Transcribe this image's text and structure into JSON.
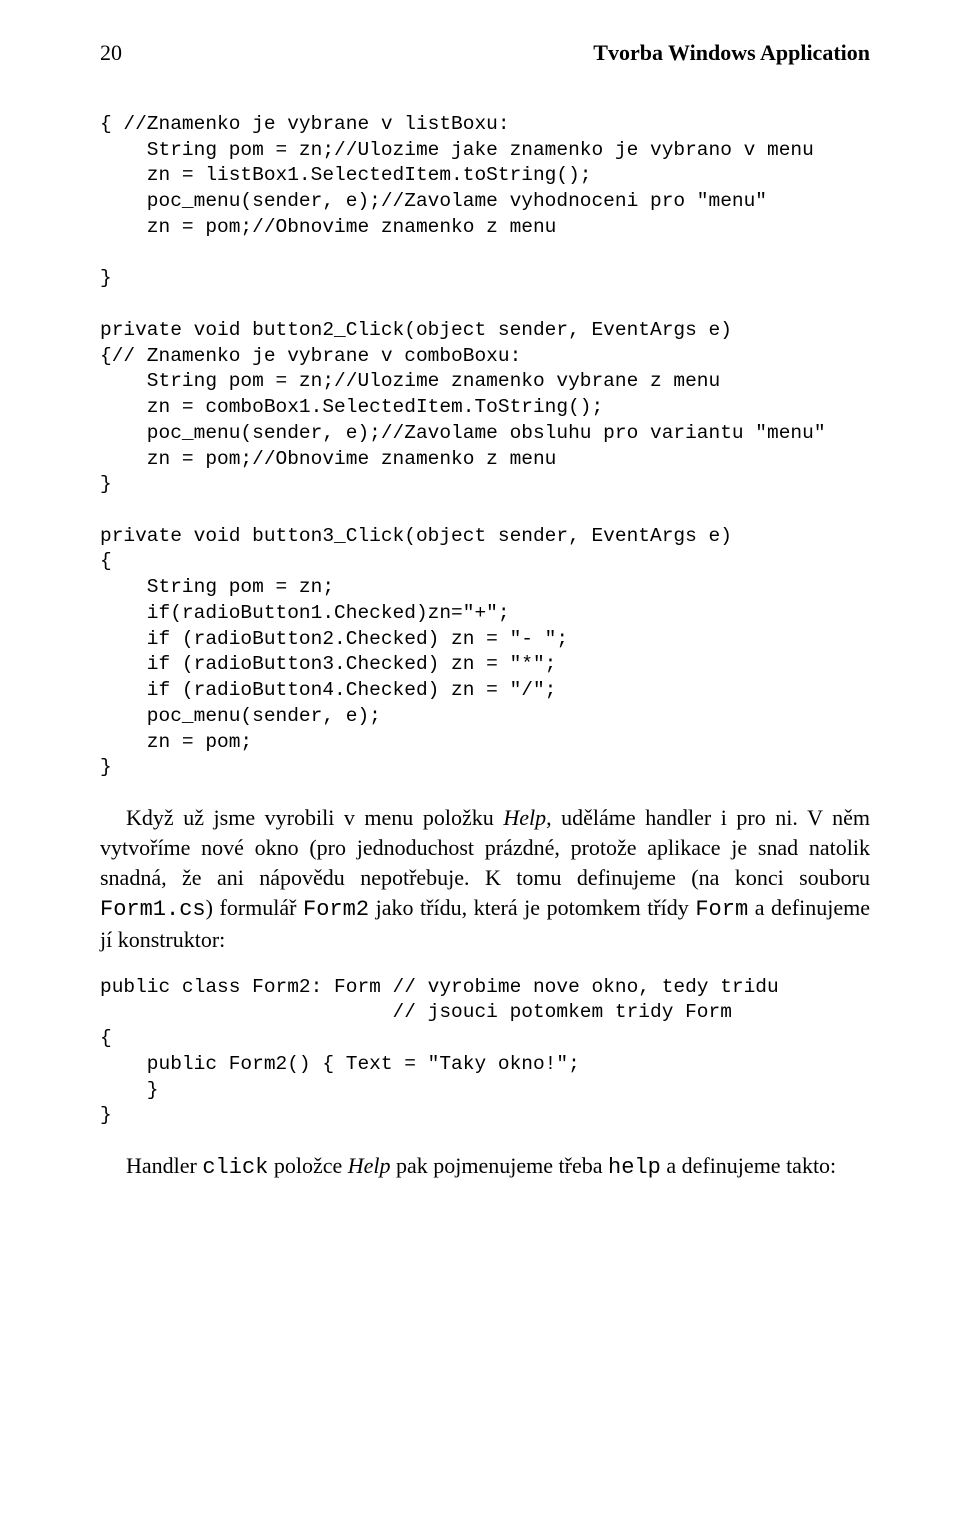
{
  "header": {
    "page_number": "20",
    "chapter_title": "Tvorba Windows Application"
  },
  "code1": "{ //Znamenko je vybrane v listBoxu:\n    String pom = zn;//Ulozime jake znamenko je vybrano v menu\n    zn = listBox1.SelectedItem.toString();\n    poc_menu(sender, e);//Zavolame vyhodnoceni pro \"menu\"\n    zn = pom;//Obnovime znamenko z menu\n\n}\n\nprivate void button2_Click(object sender, EventArgs e)\n{// Znamenko je vybrane v comboBoxu:\n    String pom = zn;//Ulozime znamenko vybrane z menu\n    zn = comboBox1.SelectedItem.ToString();\n    poc_menu(sender, e);//Zavolame obsluhu pro variantu \"menu\"\n    zn = pom;//Obnovime znamenko z menu\n}\n\nprivate void button3_Click(object sender, EventArgs e)\n{\n    String pom = zn;\n    if(radioButton1.Checked)zn=\"+\";\n    if (radioButton2.Checked) zn = \"- \";\n    if (radioButton3.Checked) zn = \"*\";\n    if (radioButton4.Checked) zn = \"/\";\n    poc_menu(sender, e);\n    zn = pom;\n}",
  "para1": {
    "t1": "Když už jsme vyrobili v menu položku ",
    "t2": "Help",
    "t3": ", uděláme handler i pro ni. V něm vytvoříme nové okno (pro jednoduchost prázdné, protože aplikace je snad natolik snadná, že ani nápovědu nepotřebuje. K tomu definujeme (na konci souboru ",
    "t4": "Form1.cs",
    "t5": ") formulář ",
    "t6": "Form2",
    "t7": " jako třídu, která je potomkem třídy ",
    "t8": "Form",
    "t9": " a definujeme jí konstruktor:"
  },
  "code2": "public class Form2: Form // vyrobime nove okno, tedy tridu\n                         // jsouci potomkem tridy Form\n{\n    public Form2() { Text = \"Taky okno!\";\n    }\n}",
  "para2": {
    "t1": "Handler ",
    "t2": "click",
    "t3": " položce ",
    "t4": "Help",
    "t5": " pak pojmenujeme třeba ",
    "t6": "help",
    "t7": " a definujeme takto:"
  }
}
